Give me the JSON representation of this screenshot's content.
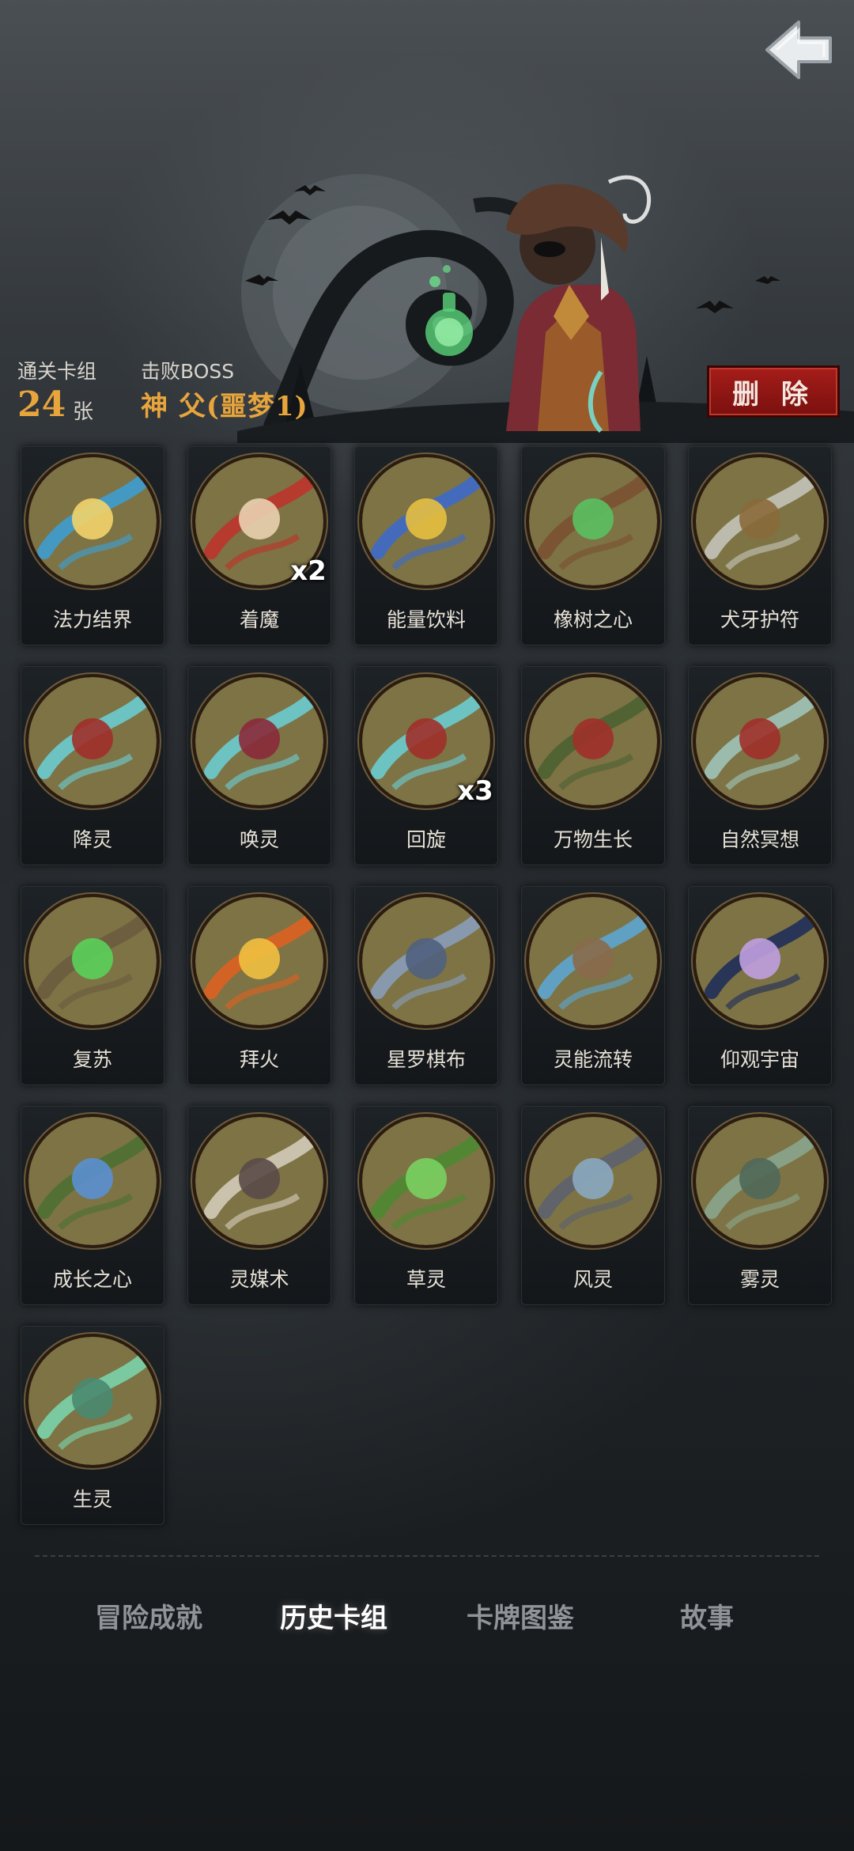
{
  "header": {
    "clear_deck_label": "通关卡组",
    "card_count": "24",
    "card_unit": "张",
    "defeated_boss_label": "击败BOSS",
    "boss_name": "神 父(噩梦1)",
    "delete_label": "删 除"
  },
  "cards": [
    {
      "name": "法力结界",
      "count": "",
      "icon": "mana-barrier-art"
    },
    {
      "name": "着魔",
      "count": "x2",
      "icon": "possessed-art"
    },
    {
      "name": "能量饮料",
      "count": "",
      "icon": "energy-drink-art"
    },
    {
      "name": "橡树之心",
      "count": "",
      "icon": "oak-heart-art"
    },
    {
      "name": "犬牙护符",
      "count": "",
      "icon": "fang-amulet-art"
    },
    {
      "name": "降灵",
      "count": "",
      "icon": "summon-spirit-art"
    },
    {
      "name": "唤灵",
      "count": "",
      "icon": "call-spirit-art"
    },
    {
      "name": "回旋",
      "count": "x3",
      "icon": "swirl-art"
    },
    {
      "name": "万物生长",
      "count": "",
      "icon": "growth-art"
    },
    {
      "name": "自然冥想",
      "count": "",
      "icon": "meditation-art"
    },
    {
      "name": "复苏",
      "count": "",
      "icon": "revive-art"
    },
    {
      "name": "拜火",
      "count": "",
      "icon": "fire-worship-art"
    },
    {
      "name": "星罗棋布",
      "count": "",
      "icon": "star-scatter-art"
    },
    {
      "name": "灵能流转",
      "count": "",
      "icon": "psi-flow-art"
    },
    {
      "name": "仰观宇宙",
      "count": "",
      "icon": "cosmos-art"
    },
    {
      "name": "成长之心",
      "count": "",
      "icon": "growth-heart-art"
    },
    {
      "name": "灵媒术",
      "count": "",
      "icon": "medium-art"
    },
    {
      "name": "草灵",
      "count": "",
      "icon": "grass-spirit-art"
    },
    {
      "name": "风灵",
      "count": "",
      "icon": "wind-spirit-art"
    },
    {
      "name": "雾灵",
      "count": "",
      "icon": "mist-spirit-art"
    },
    {
      "name": "生灵",
      "count": "",
      "icon": "life-spirit-art"
    }
  ],
  "tabs": [
    {
      "label": "冒险成就",
      "active": false
    },
    {
      "label": "历史卡组",
      "active": true
    },
    {
      "label": "卡牌图鉴",
      "active": false
    },
    {
      "label": "故事",
      "active": false
    }
  ],
  "colors": {
    "accent_gold": "#e8a53c",
    "delete_red": "#a51d1a",
    "card_bg": "#14171a",
    "art_olive": "#7d7345"
  }
}
